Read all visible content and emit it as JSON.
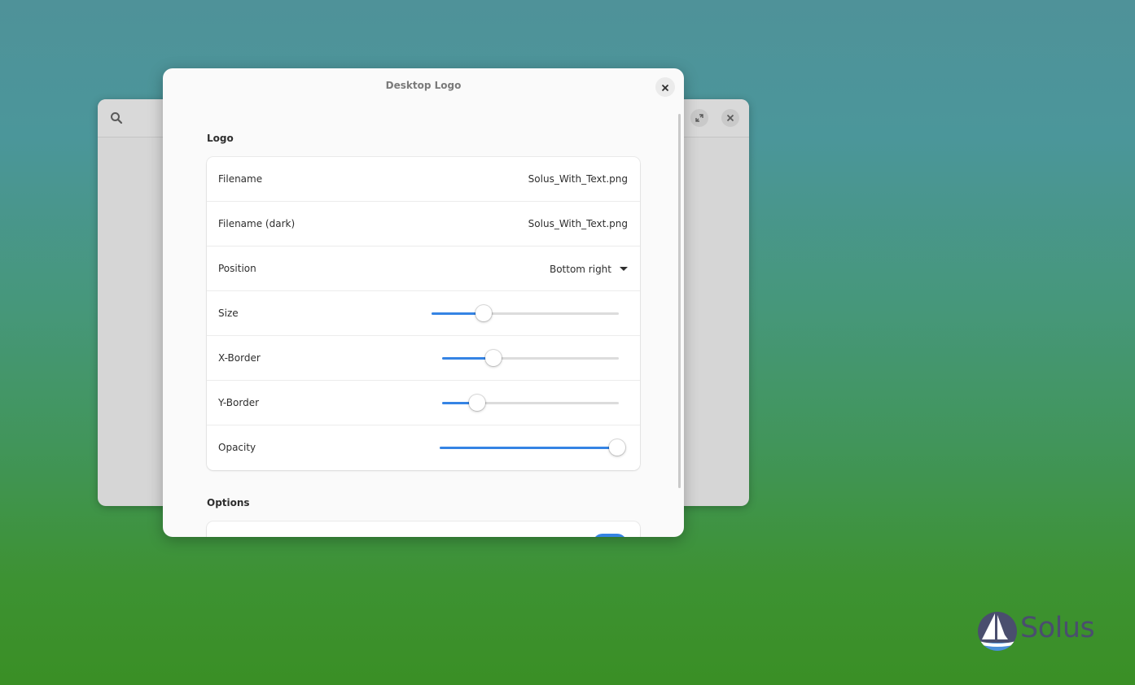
{
  "dialog": {
    "title": "Desktop Logo"
  },
  "logo_section": {
    "title": "Logo",
    "rows": {
      "filename": {
        "label": "Filename",
        "value": "Solus_With_Text.png"
      },
      "filename_dark": {
        "label": "Filename (dark)",
        "value": "Solus_With_Text.png"
      },
      "position": {
        "label": "Position",
        "value": "Bottom right"
      },
      "size": {
        "label": "Size",
        "level": 0.28
      },
      "x_border": {
        "label": "X-Border",
        "level": 0.29
      },
      "y_border": {
        "label": "Y-Border",
        "level": 0.2
      },
      "opacity": {
        "label": "Opacity",
        "level": 1.0
      }
    }
  },
  "options_section": {
    "title": "Options",
    "first_toggle_on": true
  },
  "wallpaper_logo": {
    "text": "Solus"
  },
  "colors": {
    "accent": "#3584e4",
    "logo_text": "#4a4e6e"
  },
  "icons": {
    "bg_search": "search-icon",
    "bg_restore": "restore-icon",
    "bg_close": "close-icon",
    "dialog_close": "close-icon",
    "dropdown": "chevron-down-icon"
  }
}
